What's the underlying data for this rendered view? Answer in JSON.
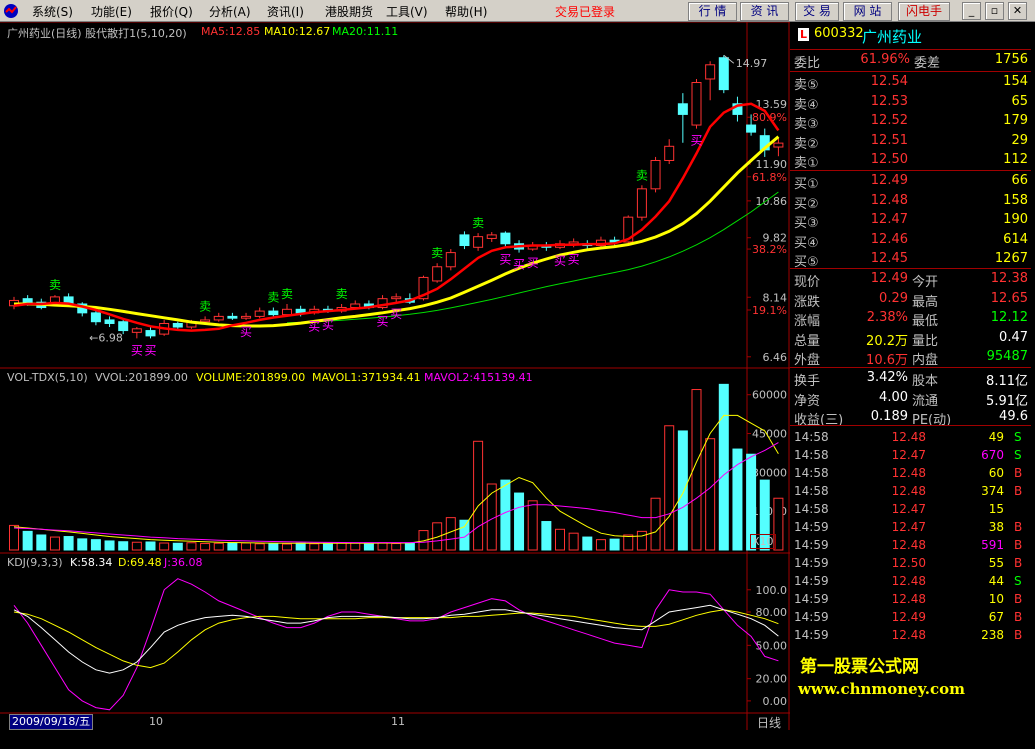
{
  "menu": {
    "items": [
      "系统(S)",
      "功能(E)",
      "报价(Q)",
      "分析(A)",
      "资讯(I)",
      "港股期货",
      "工具(V)",
      "帮助(H)"
    ],
    "status": "交易已登录",
    "toolbar": [
      "行 情",
      "资 讯",
      "交 易",
      "网 站",
      "闪电手"
    ],
    "window_controls": [
      "_",
      "▫",
      "✕"
    ]
  },
  "colors": {
    "up": "#ff3232",
    "down": "#54ffff",
    "ma5": "#ff0000",
    "ma10": "#ffff00",
    "ma20": "#00dd00",
    "mavol2": "#ff00ff"
  },
  "main_panel": {
    "title": "广州药业(日线) 股代散打1(5,10,20)",
    "ma5": "MA5:12.85",
    "ma10": "MA10:12.67",
    "ma20": "MA20:11.11",
    "high_label": "14.97",
    "low_label": "6.98",
    "sell_label": "卖",
    "buy_label": "买"
  },
  "vol_panel": {
    "title": "VOL-TDX(5,10)",
    "vvol": "VVOL:201899.00",
    "volume": "VOLUME:201899.00",
    "mavol1": "MAVOL1:371934.41",
    "mavol2": "MAVOL2:415139.41",
    "unit": "X10"
  },
  "kdj_panel": {
    "title": "KDJ(9,3,3)",
    "k": "K:58.34",
    "d": "D:69.48",
    "j": "J:36.08"
  },
  "price_axis": [
    {
      "label": "13.59",
      "value": 13.59,
      "color": "#c0c0c0"
    },
    {
      "label": "80.9%",
      "value": 13.22,
      "color": "#ff3232"
    },
    {
      "label": "11.90",
      "value": 11.9,
      "color": "#c0c0c0"
    },
    {
      "label": "61.8%",
      "value": 11.54,
      "color": "#ff3232"
    },
    {
      "label": "10.86",
      "value": 10.86,
      "color": "#c0c0c0"
    },
    {
      "label": "9.82",
      "value": 9.82,
      "color": "#c0c0c0"
    },
    {
      "label": "38.2%",
      "value": 9.5,
      "color": "#ff3232"
    },
    {
      "label": "8.14",
      "value": 8.14,
      "color": "#c0c0c0"
    },
    {
      "label": "19.1%",
      "value": 7.78,
      "color": "#ff3232"
    },
    {
      "label": "6.46",
      "value": 6.46,
      "color": "#c0c0c0"
    }
  ],
  "vol_axis": [
    "60000",
    "45000",
    "30000",
    "15000"
  ],
  "kdj_axis": [
    "100.0",
    "80.00",
    "50.00",
    "20.00",
    "0.00"
  ],
  "x_axis": {
    "date": "2009/09/18/五",
    "ticks": [
      "10",
      "11"
    ],
    "period": "日线"
  },
  "chart_data": {
    "type": "candlestick",
    "title": "广州药业(日线) 股代散打1(5,10,20)",
    "ylim": [
      6.2,
      15.4
    ],
    "candles": [
      {
        "o": 7.9,
        "c": 8.05,
        "h": 8.15,
        "l": 7.8
      },
      {
        "o": 8.1,
        "c": 7.95,
        "h": 8.2,
        "l": 7.9
      },
      {
        "o": 8.0,
        "c": 7.85,
        "h": 8.1,
        "l": 7.8
      },
      {
        "o": 7.95,
        "c": 8.15,
        "h": 8.2,
        "l": 7.9
      },
      {
        "o": 8.15,
        "c": 7.95,
        "h": 8.25,
        "l": 7.9
      },
      {
        "o": 7.95,
        "c": 7.7,
        "h": 8.0,
        "l": 7.6
      },
      {
        "o": 7.7,
        "c": 7.45,
        "h": 7.75,
        "l": 7.35
      },
      {
        "o": 7.5,
        "c": 7.4,
        "h": 7.6,
        "l": 7.3
      },
      {
        "o": 7.45,
        "c": 7.2,
        "h": 7.5,
        "l": 7.1
      },
      {
        "o": 7.15,
        "c": 7.25,
        "h": 7.3,
        "l": 6.98
      },
      {
        "o": 7.2,
        "c": 7.05,
        "h": 7.3,
        "l": 6.98
      },
      {
        "o": 7.1,
        "c": 7.4,
        "h": 7.5,
        "l": 7.05
      },
      {
        "o": 7.4,
        "c": 7.3,
        "h": 7.45,
        "l": 7.2
      },
      {
        "o": 7.3,
        "c": 7.45,
        "h": 7.5,
        "l": 7.25
      },
      {
        "o": 7.45,
        "c": 7.5,
        "h": 7.6,
        "l": 7.4
      },
      {
        "o": 7.5,
        "c": 7.6,
        "h": 7.7,
        "l": 7.45
      },
      {
        "o": 7.6,
        "c": 7.55,
        "h": 7.7,
        "l": 7.5
      },
      {
        "o": 7.55,
        "c": 7.6,
        "h": 7.7,
        "l": 7.5
      },
      {
        "o": 7.6,
        "c": 7.75,
        "h": 7.85,
        "l": 7.55
      },
      {
        "o": 7.75,
        "c": 7.65,
        "h": 7.85,
        "l": 7.6
      },
      {
        "o": 7.65,
        "c": 7.8,
        "h": 7.95,
        "l": 7.6
      },
      {
        "o": 7.8,
        "c": 7.7,
        "h": 7.9,
        "l": 7.6
      },
      {
        "o": 7.7,
        "c": 7.8,
        "h": 7.9,
        "l": 7.65
      },
      {
        "o": 7.8,
        "c": 7.75,
        "h": 7.9,
        "l": 7.7
      },
      {
        "o": 7.75,
        "c": 7.85,
        "h": 7.95,
        "l": 7.7
      },
      {
        "o": 7.85,
        "c": 7.95,
        "h": 8.05,
        "l": 7.8
      },
      {
        "o": 7.95,
        "c": 7.85,
        "h": 8.05,
        "l": 7.8
      },
      {
        "o": 7.85,
        "c": 8.1,
        "h": 8.2,
        "l": 7.8
      },
      {
        "o": 8.1,
        "c": 8.15,
        "h": 8.25,
        "l": 8.0
      },
      {
        "o": 8.1,
        "c": 8.0,
        "h": 8.25,
        "l": 7.95
      },
      {
        "o": 8.1,
        "c": 8.7,
        "h": 8.75,
        "l": 8.05
      },
      {
        "o": 8.6,
        "c": 9.0,
        "h": 9.1,
        "l": 8.55
      },
      {
        "o": 9.0,
        "c": 9.4,
        "h": 9.5,
        "l": 8.9
      },
      {
        "o": 9.9,
        "c": 9.6,
        "h": 10.0,
        "l": 9.5
      },
      {
        "o": 9.55,
        "c": 9.85,
        "h": 9.95,
        "l": 9.45
      },
      {
        "o": 9.8,
        "c": 9.9,
        "h": 9.98,
        "l": 9.7
      },
      {
        "o": 9.95,
        "c": 9.65,
        "h": 10.0,
        "l": 9.55
      },
      {
        "o": 9.65,
        "c": 9.5,
        "h": 9.75,
        "l": 9.4
      },
      {
        "o": 9.5,
        "c": 9.6,
        "h": 9.7,
        "l": 9.45
      },
      {
        "o": 9.6,
        "c": 9.55,
        "h": 9.7,
        "l": 9.45
      },
      {
        "o": 9.55,
        "c": 9.65,
        "h": 9.75,
        "l": 9.5
      },
      {
        "o": 9.65,
        "c": 9.7,
        "h": 9.8,
        "l": 9.55
      },
      {
        "o": 9.65,
        "c": 9.6,
        "h": 9.75,
        "l": 9.5
      },
      {
        "o": 9.6,
        "c": 9.75,
        "h": 9.85,
        "l": 9.55
      },
      {
        "o": 9.75,
        "c": 9.7,
        "h": 9.85,
        "l": 9.6
      },
      {
        "o": 9.7,
        "c": 10.4,
        "h": 10.45,
        "l": 9.65
      },
      {
        "o": 10.4,
        "c": 11.2,
        "h": 11.3,
        "l": 10.3
      },
      {
        "o": 11.2,
        "c": 12.0,
        "h": 12.1,
        "l": 11.1
      },
      {
        "o": 12.0,
        "c": 12.4,
        "h": 12.6,
        "l": 11.9
      },
      {
        "o": 13.6,
        "c": 13.3,
        "h": 13.9,
        "l": 12.5
      },
      {
        "o": 13.0,
        "c": 14.2,
        "h": 14.3,
        "l": 12.9
      },
      {
        "o": 14.3,
        "c": 14.7,
        "h": 14.8,
        "l": 13.7
      },
      {
        "o": 14.9,
        "c": 14.0,
        "h": 14.97,
        "l": 13.9
      },
      {
        "o": 13.6,
        "c": 13.3,
        "h": 13.8,
        "l": 13.1
      },
      {
        "o": 13.0,
        "c": 12.8,
        "h": 13.3,
        "l": 12.7
      },
      {
        "o": 12.7,
        "c": 12.3,
        "h": 12.9,
        "l": 12.1
      },
      {
        "o": 12.38,
        "c": 12.49,
        "h": 12.65,
        "l": 12.12
      }
    ],
    "ma5": [
      7.9,
      7.95,
      7.95,
      7.98,
      7.96,
      7.88,
      7.78,
      7.66,
      7.53,
      7.42,
      7.32,
      7.26,
      7.22,
      7.2,
      7.22,
      7.25,
      7.35,
      7.42,
      7.5,
      7.57,
      7.62,
      7.67,
      7.72,
      7.75,
      7.78,
      7.82,
      7.86,
      7.92,
      7.98,
      8.05,
      8.2,
      8.38,
      8.65,
      8.95,
      9.25,
      9.45,
      9.55,
      9.58,
      9.6,
      9.6,
      9.62,
      9.62,
      9.64,
      9.64,
      9.66,
      9.78,
      10.05,
      10.42,
      10.85,
      11.5,
      12.2,
      12.95,
      13.35,
      13.55,
      13.6,
      13.4,
      12.85
    ],
    "ma10": [
      7.95,
      7.95,
      7.94,
      7.92,
      7.9,
      7.88,
      7.85,
      7.8,
      7.74,
      7.68,
      7.62,
      7.56,
      7.5,
      7.44,
      7.4,
      7.36,
      7.34,
      7.33,
      7.33,
      7.34,
      7.37,
      7.41,
      7.46,
      7.51,
      7.56,
      7.6,
      7.65,
      7.7,
      7.76,
      7.82,
      7.9,
      8.0,
      8.12,
      8.28,
      8.45,
      8.62,
      8.8,
      8.96,
      9.1,
      9.22,
      9.33,
      9.41,
      9.48,
      9.53,
      9.57,
      9.63,
      9.72,
      9.84,
      10.0,
      10.22,
      10.5,
      10.85,
      11.25,
      11.65,
      12.0,
      12.35,
      12.67
    ],
    "ma20": [
      null,
      null,
      null,
      null,
      null,
      null,
      null,
      null,
      null,
      null,
      null,
      null,
      null,
      null,
      null,
      null,
      null,
      null,
      null,
      null,
      7.42,
      7.43,
      7.45,
      7.47,
      7.49,
      7.52,
      7.55,
      7.58,
      7.62,
      7.66,
      7.71,
      7.77,
      7.84,
      7.92,
      8.0,
      8.08,
      8.17,
      8.26,
      8.35,
      8.44,
      8.52,
      8.6,
      8.68,
      8.76,
      8.84,
      8.92,
      9.02,
      9.14,
      9.28,
      9.44,
      9.62,
      9.82,
      10.05,
      10.3,
      10.55,
      10.83,
      11.11
    ],
    "volume": [
      9500,
      7200,
      5800,
      5000,
      5200,
      4300,
      4000,
      3500,
      3200,
      3000,
      3100,
      2700,
      2600,
      2800,
      2500,
      2600,
      2800,
      2700,
      2400,
      2500,
      2300,
      2600,
      2400,
      2500,
      2800,
      2700,
      2600,
      2800,
      2500,
      2600,
      7500,
      10500,
      12500,
      11500,
      42000,
      25500,
      27000,
      22000,
      19000,
      11000,
      8000,
      6500,
      5000,
      4000,
      4200,
      5800,
      7200,
      20000,
      48000,
      46000,
      62000,
      43000,
      64000,
      39000,
      37000,
      27000,
      20000
    ],
    "mavol1": [
      9000,
      8500,
      8000,
      7500,
      7000,
      6400,
      5800,
      5200,
      4800,
      4400,
      4000,
      3800,
      3600,
      3400,
      3200,
      3000,
      2900,
      2800,
      2700,
      2650,
      2600,
      2600,
      2600,
      2600,
      2600,
      2620,
      2640,
      2660,
      2680,
      2700,
      3500,
      5000,
      7000,
      9000,
      17000,
      22000,
      25000,
      28000,
      26000,
      20000,
      15000,
      12000,
      9000,
      6500,
      5500,
      5200,
      5400,
      7000,
      13000,
      22000,
      34000,
      45000,
      52000,
      52000,
      49000,
      46000,
      37193
    ],
    "mavol2": [
      8500,
      8300,
      8000,
      7700,
      7400,
      7000,
      6600,
      6200,
      5800,
      5400,
      5000,
      4700,
      4400,
      4200,
      4000,
      3800,
      3650,
      3500,
      3400,
      3300,
      3200,
      3100,
      3000,
      2950,
      2900,
      2870,
      2850,
      2850,
      2850,
      2850,
      3000,
      3500,
      4200,
      5000,
      9000,
      12000,
      14500,
      16500,
      17500,
      17500,
      17000,
      16500,
      16000,
      15200,
      14500,
      13500,
      12500,
      12500,
      14000,
      16500,
      20000,
      24000,
      29000,
      33000,
      36000,
      38500,
      41514
    ],
    "kdj_k": [
      82,
      76,
      66,
      55,
      44,
      35,
      28,
      25,
      28,
      35,
      48,
      62,
      68,
      72,
      75,
      76,
      77,
      76,
      74,
      72,
      70,
      70,
      72,
      75,
      76,
      76,
      76,
      76,
      75,
      74,
      74,
      75,
      77,
      78,
      80,
      82,
      82,
      80,
      78,
      76,
      74,
      72,
      70,
      68,
      66,
      65,
      64,
      72,
      80,
      82,
      84,
      86,
      82,
      78,
      74,
      68,
      58.34
    ],
    "kdj_d": [
      80,
      78,
      74,
      68,
      62,
      55,
      48,
      42,
      36,
      32,
      30,
      34,
      44,
      55,
      64,
      70,
      73,
      75,
      76,
      76,
      75,
      74,
      74,
      74,
      74,
      74,
      75,
      75,
      75,
      75,
      75,
      75,
      75,
      76,
      76,
      77,
      78,
      79,
      79,
      78,
      77,
      76,
      74,
      72,
      70,
      68,
      67,
      67,
      69,
      73,
      77,
      80,
      82,
      80,
      77,
      74,
      69.48
    ],
    "kdj_j": [
      86,
      70,
      50,
      30,
      10,
      0,
      -6,
      -8,
      5,
      30,
      64,
      100,
      110,
      105,
      98,
      90,
      85,
      80,
      75,
      70,
      66,
      66,
      70,
      76,
      80,
      80,
      78,
      76,
      74,
      72,
      72,
      74,
      80,
      84,
      88,
      92,
      90,
      82,
      76,
      72,
      68,
      64,
      60,
      56,
      52,
      50,
      48,
      82,
      100,
      98,
      98,
      96,
      82,
      68,
      58,
      40,
      36.08
    ],
    "signals": [
      {
        "type": "sell",
        "i": 3
      },
      {
        "type": "buy",
        "i": 9
      },
      {
        "type": "buy",
        "i": 10
      },
      {
        "type": "sell",
        "i": 14
      },
      {
        "type": "buy",
        "i": 17
      },
      {
        "type": "sell",
        "i": 19
      },
      {
        "type": "sell",
        "i": 20
      },
      {
        "type": "buy",
        "i": 22
      },
      {
        "type": "buy",
        "i": 23
      },
      {
        "type": "sell",
        "i": 24
      },
      {
        "type": "buy",
        "i": 27
      },
      {
        "type": "buy",
        "i": 28
      },
      {
        "type": "sell",
        "i": 31
      },
      {
        "type": "sell",
        "i": 34
      },
      {
        "type": "buy",
        "i": 36
      },
      {
        "type": "buy",
        "i": 37
      },
      {
        "type": "buy",
        "i": 38
      },
      {
        "type": "buy",
        "i": 40
      },
      {
        "type": "buy",
        "i": 41
      },
      {
        "type": "sell",
        "i": 46
      },
      {
        "type": "buy",
        "i": 50
      }
    ]
  },
  "quote": {
    "code": "600332",
    "name": "广州药业",
    "logo": "L",
    "weibi_label": "委比",
    "weibi": "61.96%",
    "weicha_label": "委差",
    "weicha": "1756",
    "sells": [
      {
        "label": "卖⑤",
        "price": "12.54",
        "vol": "154"
      },
      {
        "label": "卖④",
        "price": "12.53",
        "vol": "65"
      },
      {
        "label": "卖③",
        "price": "12.52",
        "vol": "179"
      },
      {
        "label": "卖②",
        "price": "12.51",
        "vol": "29"
      },
      {
        "label": "卖①",
        "price": "12.50",
        "vol": "112"
      }
    ],
    "buys": [
      {
        "label": "买①",
        "price": "12.49",
        "vol": "66"
      },
      {
        "label": "买②",
        "price": "12.48",
        "vol": "158"
      },
      {
        "label": "买③",
        "price": "12.47",
        "vol": "190"
      },
      {
        "label": "买④",
        "price": "12.46",
        "vol": "614"
      },
      {
        "label": "买⑤",
        "price": "12.45",
        "vol": "1267"
      }
    ],
    "stats": [
      {
        "l1": "现价",
        "v1": "12.49",
        "c1": "#ff3232",
        "l2": "今开",
        "v2": "12.38",
        "c2": "#ff3232"
      },
      {
        "l1": "涨跌",
        "v1": "0.29",
        "c1": "#ff3232",
        "l2": "最高",
        "v2": "12.65",
        "c2": "#ff3232"
      },
      {
        "l1": "涨幅",
        "v1": "2.38%",
        "c1": "#ff3232",
        "l2": "最低",
        "v2": "12.12",
        "c2": "#00ff00"
      },
      {
        "l1": "总量",
        "v1": "20.2万",
        "c1": "#ffff00",
        "l2": "量比",
        "v2": "0.47",
        "c2": "#ffffff"
      },
      {
        "l1": "外盘",
        "v1": "10.6万",
        "c1": "#ff3232",
        "l2": "内盘",
        "v2": "95487",
        "c2": "#00ff00"
      }
    ],
    "info": [
      {
        "l1": "换手",
        "v1": "3.42%",
        "l2": "股本",
        "v2": "8.11亿"
      },
      {
        "l1": "净资",
        "v1": "4.00",
        "l2": "流通",
        "v2": "5.91亿"
      },
      {
        "l1": "收益(三)",
        "v1": "0.189",
        "l2": "PE(动)",
        "v2": "49.6"
      }
    ],
    "ticks": [
      {
        "t": "14:58",
        "p": "12.48",
        "v": "49",
        "s": "S",
        "pc": "#ff3232",
        "vc": "#ffff00",
        "sc": "#00ff00"
      },
      {
        "t": "14:58",
        "p": "12.47",
        "v": "670",
        "s": "S",
        "pc": "#ff3232",
        "vc": "#ff00ff",
        "sc": "#00ff00"
      },
      {
        "t": "14:58",
        "p": "12.48",
        "v": "60",
        "s": "B",
        "pc": "#ff3232",
        "vc": "#ffff00",
        "sc": "#ff3232"
      },
      {
        "t": "14:58",
        "p": "12.48",
        "v": "374",
        "s": "B",
        "pc": "#ff3232",
        "vc": "#ffff00",
        "sc": "#ff3232"
      },
      {
        "t": "14:58",
        "p": "12.47",
        "v": "15",
        "s": "",
        "pc": "#ff3232",
        "vc": "#ffff00",
        "sc": "#c0c0c0"
      },
      {
        "t": "14:59",
        "p": "12.47",
        "v": "38",
        "s": "B",
        "pc": "#ff3232",
        "vc": "#ffff00",
        "sc": "#ff3232"
      },
      {
        "t": "14:59",
        "p": "12.48",
        "v": "591",
        "s": "B",
        "pc": "#ff3232",
        "vc": "#ff00ff",
        "sc": "#ff3232"
      },
      {
        "t": "14:59",
        "p": "12.50",
        "v": "55",
        "s": "B",
        "pc": "#ff3232",
        "vc": "#ffff00",
        "sc": "#ff3232"
      },
      {
        "t": "14:59",
        "p": "12.48",
        "v": "44",
        "s": "S",
        "pc": "#ff3232",
        "vc": "#ffff00",
        "sc": "#00ff00"
      },
      {
        "t": "14:59",
        "p": "12.48",
        "v": "10",
        "s": "B",
        "pc": "#ff3232",
        "vc": "#ffff00",
        "sc": "#ff3232"
      },
      {
        "t": "14:59",
        "p": "12.49",
        "v": "67",
        "s": "B",
        "pc": "#ff3232",
        "vc": "#ffff00",
        "sc": "#ff3232"
      },
      {
        "t": "14:59",
        "p": "12.48",
        "v": "238",
        "s": "B",
        "pc": "#ff3232",
        "vc": "#ffff00",
        "sc": "#ff3232"
      }
    ]
  },
  "watermark": {
    "line1": "第一股票公式网",
    "line2": "www.chnmoney.com"
  }
}
